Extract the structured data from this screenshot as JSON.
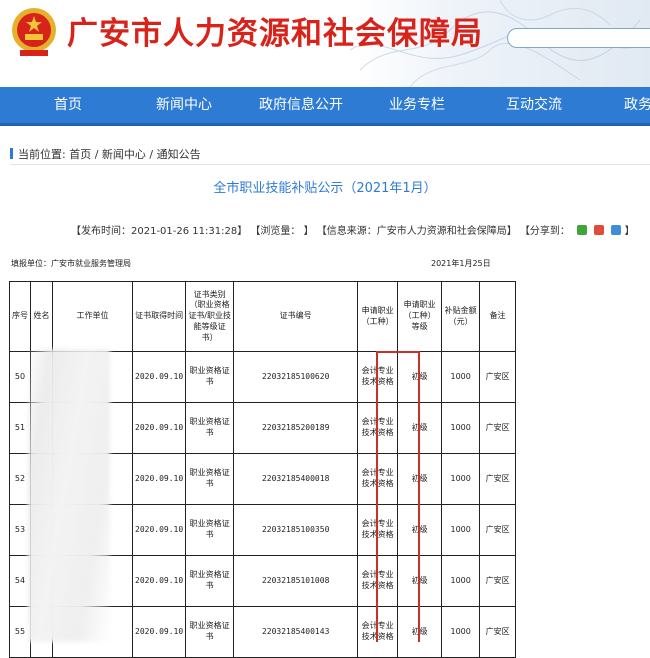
{
  "header": {
    "site_title": "广安市人力资源和社会保障局",
    "search_placeholder": ""
  },
  "nav": [
    "首页",
    "新闻中心",
    "政府信息公开",
    "业务专栏",
    "互动交流",
    "政务"
  ],
  "breadcrumb": "当前位置: 首页 / 新闻中心 / 通知公告",
  "article": {
    "title": "全市职业技能补贴公示（2021年1月）",
    "meta": "【发布时间：2021-01-26 11:31:28】 【浏览量：  】 【信息来源：广安市人力资源和社会保障局】 【分享到：",
    "meta_end": "】"
  },
  "document": {
    "fill_unit": "填报单位：广安市就业服务管理局",
    "fill_date": "2021年1月25日",
    "columns": [
      "序号",
      "姓名",
      "工作单位",
      "证书取得时间",
      "证书类别（职业资格证书/职业技能等级证书）",
      "证书编号",
      "申请职业（工种）",
      "申请职业（工种）等级",
      "补贴金额（元）",
      "备注"
    ],
    "rows": [
      {
        "no": "50",
        "date": "2020.09.10",
        "type": "职业资格证书",
        "cert": "22032185100620",
        "occupation": "会计专业技术资格",
        "level": "初级",
        "amount": "1000",
        "note": "广安区"
      },
      {
        "no": "51",
        "date": "2020.09.10",
        "type": "职业资格证书",
        "cert": "22032185200189",
        "occupation": "会计专业技术资格",
        "level": "初级",
        "amount": "1000",
        "note": "广安区"
      },
      {
        "no": "52",
        "date": "2020.09.10",
        "type": "职业资格证书",
        "cert": "22032185400018",
        "occupation": "会计专业技术资格",
        "level": "初级",
        "amount": "1000",
        "note": "广安区"
      },
      {
        "no": "53",
        "date": "2020.09.10",
        "type": "职业资格证书",
        "cert": "22032185100350",
        "occupation": "会计专业技术资格",
        "level": "初级",
        "amount": "1000",
        "note": "广安区"
      },
      {
        "no": "54",
        "date": "2020.09.10",
        "type": "职业资格证书",
        "cert": "22032185101008",
        "occupation": "会计专业技术资格",
        "level": "初级",
        "amount": "1000",
        "note": "广安区"
      },
      {
        "no": "55",
        "date": "2020.09.10",
        "type": "职业资格证书",
        "cert": "22032185400143",
        "occupation": "会计专业技术资格",
        "level": "初级",
        "amount": "1000",
        "note": "广安区"
      }
    ]
  },
  "icons": {
    "emblem": "national-emblem-icon",
    "share": [
      "wechat-icon",
      "weibo-icon",
      "qzone-icon"
    ]
  }
}
